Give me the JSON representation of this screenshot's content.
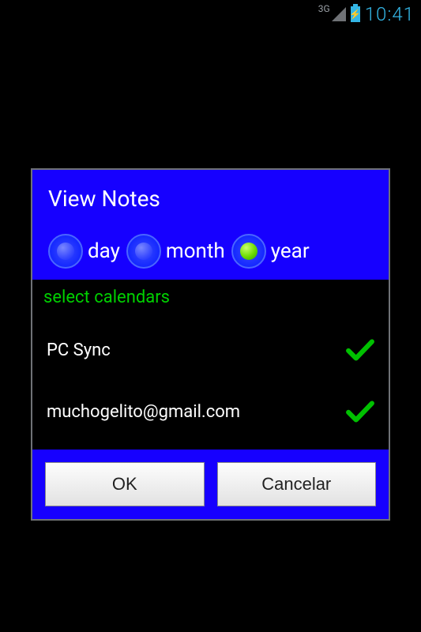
{
  "statusbar": {
    "network_label": "3G",
    "time": "10:41"
  },
  "dialog": {
    "title": "View Notes",
    "radios": {
      "day": "day",
      "month": "month",
      "year": "year",
      "selected": "year"
    },
    "select_calendars_label": "select calendars",
    "calendars": [
      {
        "name": "PC Sync",
        "checked": true
      },
      {
        "name": "muchogelito@gmail.com",
        "checked": true
      }
    ],
    "buttons": {
      "ok": "OK",
      "cancel": "Cancelar"
    }
  }
}
